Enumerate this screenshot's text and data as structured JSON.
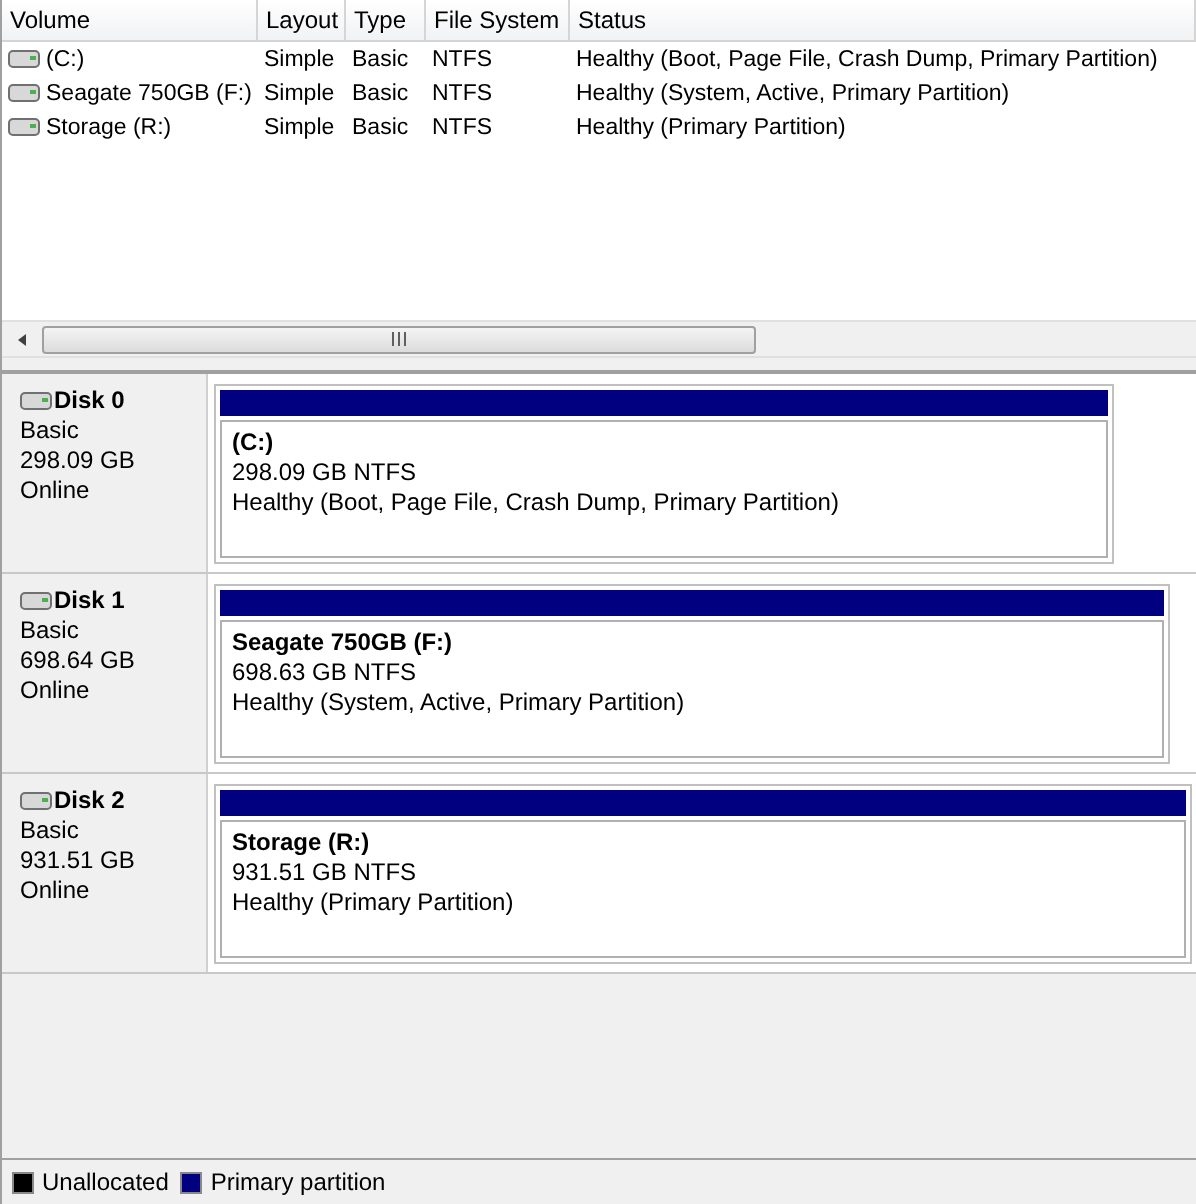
{
  "volume_table": {
    "columns": [
      "Volume",
      "Layout",
      "Type",
      "File System",
      "Status"
    ],
    "rows": [
      {
        "volume": "(C:)",
        "layout": "Simple",
        "type": "Basic",
        "file_system": "NTFS",
        "status": "Healthy (Boot, Page File, Crash Dump, Primary Partition)"
      },
      {
        "volume": "Seagate 750GB (F:)",
        "layout": "Simple",
        "type": "Basic",
        "file_system": "NTFS",
        "status": "Healthy (System, Active, Primary Partition)"
      },
      {
        "volume": "Storage (R:)",
        "layout": "Simple",
        "type": "Basic",
        "file_system": "NTFS",
        "status": "Healthy (Primary Partition)"
      }
    ]
  },
  "disks": [
    {
      "name": "Disk 0",
      "type": "Basic",
      "size": "298.09 GB",
      "state": "Online",
      "partition": {
        "name": "(C:)",
        "size": "298.09 GB NTFS",
        "status": "Healthy (Boot, Page File, Crash Dump, Primary Partition)"
      }
    },
    {
      "name": "Disk 1",
      "type": "Basic",
      "size": "698.64 GB",
      "state": "Online",
      "partition": {
        "name": "Seagate 750GB  (F:)",
        "size": "698.63 GB NTFS",
        "status": "Healthy (System, Active, Primary Partition)"
      }
    },
    {
      "name": "Disk 2",
      "type": "Basic",
      "size": "931.51 GB",
      "state": "Online",
      "partition": {
        "name": "Storage  (R:)",
        "size": "931.51 GB NTFS",
        "status": "Healthy (Primary Partition)"
      }
    }
  ],
  "legend": [
    {
      "label": "Unallocated",
      "color": "#000000"
    },
    {
      "label": "Primary partition",
      "color": "#000080"
    }
  ]
}
